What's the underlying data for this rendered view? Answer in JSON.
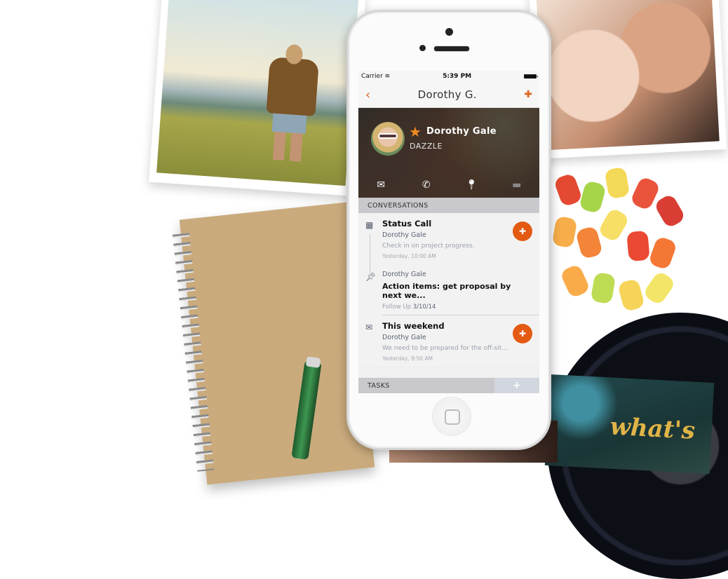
{
  "status_bar": {
    "carrier": "Carrier",
    "wifi_icon": "wifi-icon",
    "time": "5:39 PM",
    "battery_icon": "battery-icon"
  },
  "nav": {
    "back_icon": "chevron-left-icon",
    "back_glyph": "‹",
    "title": "Dorothy G.",
    "pin_icon": "pin-add-icon",
    "pin_glyph": "✚"
  },
  "profile": {
    "name": "Dorothy Gale",
    "company": "DAZZLE",
    "favorite_glyph": "★",
    "actions": [
      {
        "icon": "email-icon",
        "glyph": "✉"
      },
      {
        "icon": "phone-icon",
        "glyph": "✆"
      },
      {
        "icon": "location-icon",
        "glyph": "⬤"
      },
      {
        "icon": "message-icon",
        "glyph": "▬"
      }
    ]
  },
  "conversations": {
    "header": "CONVERSATIONS",
    "items": [
      {
        "icon": "calendar-icon",
        "glyph": "▦",
        "title": "Status Call",
        "contact": "Dorothy Gale",
        "description": "Check in on project progress.",
        "timestamp": "Yesterday, 10:00 AM",
        "has_pin_button": true
      },
      {
        "icon": "pin-icon",
        "glyph": "⊥",
        "contact": "Dorothy Gale",
        "action": "Action items: get proposal by next we...",
        "follow_up_label": "Follow Up",
        "follow_up_date": "3/10/14"
      },
      {
        "icon": "mail-icon",
        "glyph": "✉",
        "title": "This weekend",
        "contact": "Dorothy Gale",
        "description": "We need to be prepared for the off-sit...",
        "timestamp": "Yesterday, 9:50 AM",
        "has_pin_button": true
      }
    ],
    "pin_button_glyph": "✚"
  },
  "tasks": {
    "header": "TASKS",
    "add_glyph": "+"
  },
  "background": {
    "album_text": "what's"
  },
  "colors": {
    "accent": "#e35a13",
    "nav_accent": "#e0631a",
    "star": "#f08a24",
    "section_bg": "#c9c8cd"
  }
}
